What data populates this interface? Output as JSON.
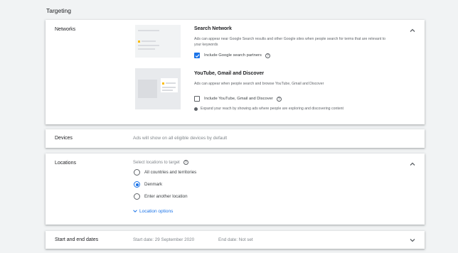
{
  "section_title": "Targeting",
  "networks": {
    "label": "Networks",
    "search": {
      "title": "Search Network",
      "description": "Ads can appear near Google Search results and other Google sites when people search for terms that are relevant to your keywords",
      "checkbox_label": "Include Google search partners",
      "checked": true
    },
    "display": {
      "title": "YouTube, Gmail and Discover",
      "description": "Ads can appear when people search and browse YouTube, Gmail and Discover",
      "checkbox_label": "Include YouTube, Gmail and Discover",
      "checked": false,
      "info": "Expand your reach by showing ads where people are exploring and discovering content"
    },
    "help_icon_glyph": "?"
  },
  "devices": {
    "label": "Devices",
    "summary": "Ads will show on all eligible devices by default"
  },
  "locations": {
    "label": "Locations",
    "prompt": "Select locations to target",
    "options": [
      {
        "label": "All countries and territories",
        "selected": false
      },
      {
        "label": "Denmark",
        "selected": true
      },
      {
        "label": "Enter another location",
        "selected": false
      }
    ],
    "more_link": "Location options"
  },
  "dates": {
    "label": "Start and end dates",
    "start": "Start date: 29 September 2020",
    "end": "End date: Not set"
  },
  "colors": {
    "accent": "#1a73e8",
    "illustration_yellow": "#fbbc04",
    "background": "#f1f3f4"
  },
  "icons": {
    "expand_up": "chevron-up-icon",
    "expand_down": "chevron-down-icon",
    "help": "help-circle-icon",
    "info": "info-dot-icon"
  }
}
